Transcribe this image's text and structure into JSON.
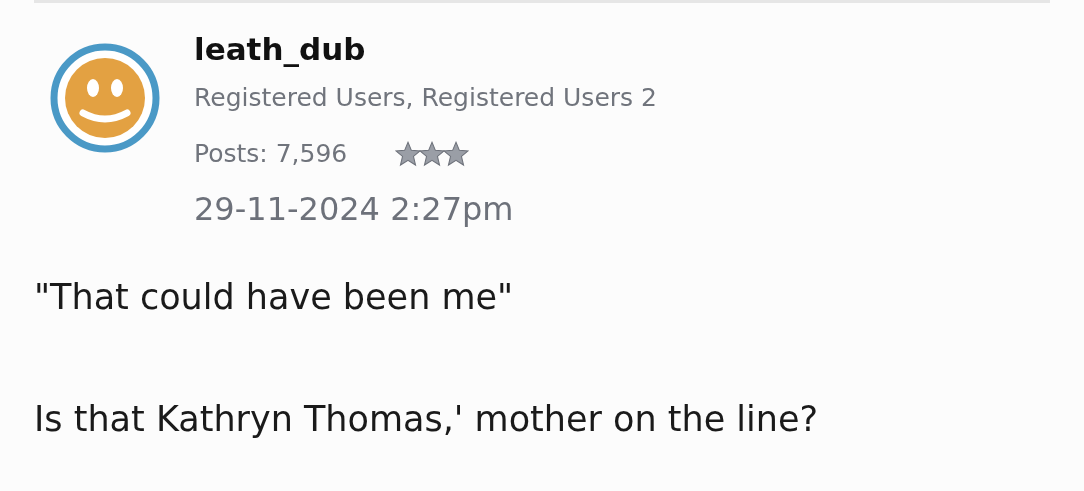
{
  "post": {
    "author": {
      "username": "leath_dub",
      "roles": "Registered Users, Registered Users 2",
      "posts": "Posts: 7,596",
      "stars": 3
    },
    "timestamp": "29-11-2024 2:27pm",
    "body": [
      "\"That could have been me\"",
      "Is that Kathryn Thomas,' mother on the line?"
    ]
  }
}
